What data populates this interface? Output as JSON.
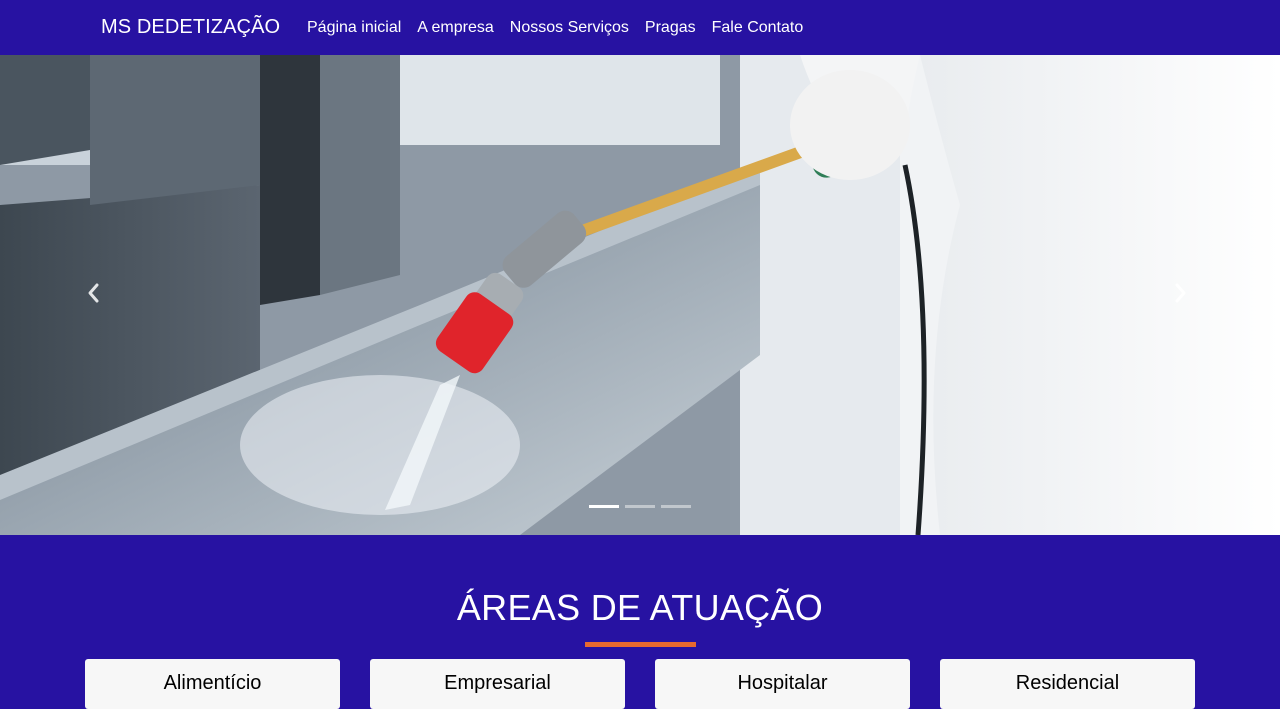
{
  "navbar": {
    "brand": "MS DEDETIZAÇÃO",
    "links": [
      {
        "label": "Página inicial"
      },
      {
        "label": "A empresa"
      },
      {
        "label": "Nossos Serviços"
      },
      {
        "label": "Pragas"
      },
      {
        "label": "Fale Contato"
      }
    ]
  },
  "carousel": {
    "slide_count": 3,
    "active_index": 0,
    "prev_icon": "chevron-left-icon",
    "next_icon": "chevron-right-icon"
  },
  "areas": {
    "title": "ÁREAS DE ATUAÇÃO",
    "cards": [
      {
        "label": "Alimentício"
      },
      {
        "label": "Empresarial"
      },
      {
        "label": "Hospitalar"
      },
      {
        "label": "Residencial"
      }
    ]
  },
  "colors": {
    "primary": "#2712a2",
    "accent": "#e8692f",
    "card_bg": "#f7f7f7"
  }
}
